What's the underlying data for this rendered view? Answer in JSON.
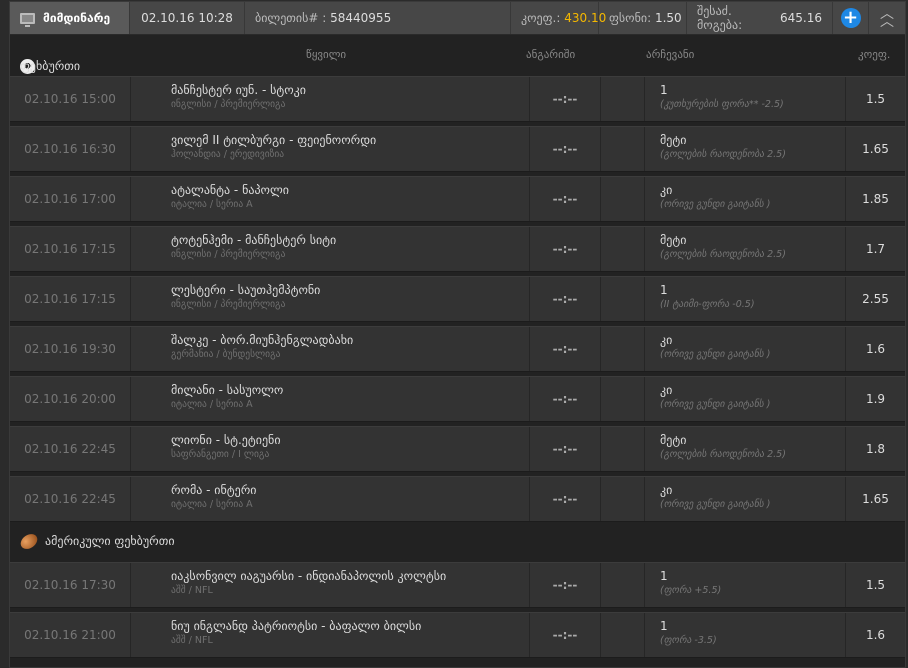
{
  "topbar": {
    "current_tab": "მიმდინარე",
    "datetime": "02.10.16 10:28",
    "ticket_label": "ბილეთის# :",
    "ticket_number": "58440955",
    "coef_label": "კოეფ.:",
    "coef_value": "430.10",
    "stake_label": "ფსონი:",
    "stake_value": "1.50",
    "potential_label": "შესაძ. მოგება:",
    "potential_value": "645.16",
    "accent": "#f5b800",
    "plus_color": "#1e88e5"
  },
  "columns": {
    "match": "წყვილი",
    "score": "ანგარიში",
    "selection": "არჩევანი",
    "odds": "კოეფ."
  },
  "sections": [
    {
      "title": "ფეხბურთი",
      "icon": "soccer-ball-icon",
      "rows": [
        {
          "date": "02.10.16 15:00",
          "match": "მანჩესტერ იუნ. - სტოკი",
          "league": "ინგლისი / პრემიერლიგა",
          "score": "--:--",
          "selection": "1",
          "selection_detail": "(კუთხურების ფორა** -2.5)",
          "odds": "1.5"
        },
        {
          "date": "02.10.16 16:30",
          "match": "ვილემ II ტილბურგი - ფეიენოორდი",
          "league": "ჰოლანდია / ერედივიზია",
          "score": "--:--",
          "selection": "მეტი",
          "selection_detail": "(გოლების რაოდენობა 2.5)",
          "odds": "1.65"
        },
        {
          "date": "02.10.16 17:00",
          "match": "ატალანტა - ნაპოლი",
          "league": "იტალია / სერია A",
          "score": "--:--",
          "selection": "კი",
          "selection_detail": "(ორივე გუნდი გაიტანს )",
          "odds": "1.85"
        },
        {
          "date": "02.10.16 17:15",
          "match": "ტოტენჰემი - მანჩესტერ სიტი",
          "league": "ინგლისი / პრემიერლიგა",
          "score": "--:--",
          "selection": "მეტი",
          "selection_detail": "(გოლების რაოდენობა 2.5)",
          "odds": "1.7"
        },
        {
          "date": "02.10.16 17:15",
          "match": "ლესტერი - საუთჰემპტონი",
          "league": "ინგლისი / პრემიერლიგა",
          "score": "--:--",
          "selection": "1",
          "selection_detail": "(II ტაიმი-ფორა -0.5)",
          "odds": "2.55"
        },
        {
          "date": "02.10.16 19:30",
          "match": "შალკე - ბორ.მიუნჰენგლადბახი",
          "league": "გერმანია / ბუნდესლიგა",
          "score": "--:--",
          "selection": "კი",
          "selection_detail": "(ორივე გუნდი გაიტანს )",
          "odds": "1.6"
        },
        {
          "date": "02.10.16 20:00",
          "match": "მილანი - სასუოლო",
          "league": "იტალია / სერია A",
          "score": "--:--",
          "selection": "კი",
          "selection_detail": "(ორივე გუნდი გაიტანს )",
          "odds": "1.9"
        },
        {
          "date": "02.10.16 22:45",
          "match": "ლიონი - სტ.ეტიენი",
          "league": "საფრანგეთი / I ლიგა",
          "score": "--:--",
          "selection": "მეტი",
          "selection_detail": "(გოლების რაოდენობა 2.5)",
          "odds": "1.8"
        },
        {
          "date": "02.10.16 22:45",
          "match": "რომა - ინტერი",
          "league": "იტალია / სერია A",
          "score": "--:--",
          "selection": "კი",
          "selection_detail": "(ორივე გუნდი გაიტანს )",
          "odds": "1.65"
        }
      ]
    },
    {
      "title": "ამერიკული ფეხბურთი",
      "icon": "american-football-icon",
      "rows": [
        {
          "date": "02.10.16 17:30",
          "match": "იაკსონვილ იაგუარსი - ინდიანაპოლის კოლტსი",
          "league": "აშშ / NFL",
          "score": "--:--",
          "selection": "1",
          "selection_detail": "(ფორა +5.5)",
          "odds": "1.5"
        },
        {
          "date": "02.10.16 21:00",
          "match": "ნიუ ინგლანდ პატრიოტსი - ბაფალო ბილსი",
          "league": "აშშ / NFL",
          "score": "--:--",
          "selection": "1",
          "selection_detail": "(ფორა -3.5)",
          "odds": "1.6"
        }
      ]
    }
  ]
}
